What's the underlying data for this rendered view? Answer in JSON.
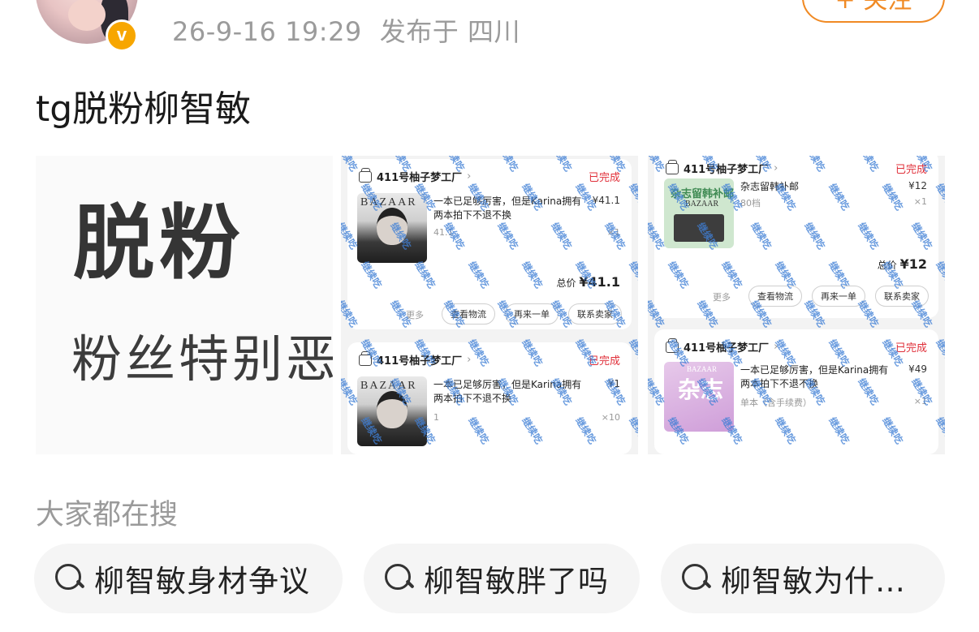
{
  "post": {
    "time": "26-9-16 19:29",
    "location": "发布于 四川",
    "follow_label": "+ 关注",
    "verified_badge": "v",
    "text": "tg脱粉柳智敏"
  },
  "image1": {
    "headline": "脱粉",
    "subline": "粉丝特别恶"
  },
  "order_shot_a": {
    "orders": [
      {
        "store": "411号柚子梦工厂",
        "status": "已完成",
        "item_name": "一本已足够厉害，但是Karina拥有两本拍下不退不换",
        "price": "¥41.1",
        "spec": "41.1",
        "qty": "×1",
        "total_label": "总价",
        "total_value": "¥41.1",
        "more": "更多",
        "actions": [
          "查看物流",
          "再来一单",
          "联系卖家"
        ],
        "thumb_mag": "BAZAAR"
      },
      {
        "store": "411号柚子梦工厂",
        "status": "已完成",
        "item_name": "一本已足够厉害，但是Karina拥有两本拍下不退不换",
        "price": "¥1",
        "spec": "1",
        "qty": "×10",
        "thumb_mag": "BAZAAR"
      }
    ]
  },
  "order_shot_b": {
    "orders": [
      {
        "store": "411号柚子梦工厂",
        "status": "已完成",
        "item_name": "杂志留韩补邮",
        "price": "¥12",
        "spec": "80档",
        "qty": "×1",
        "total_label": "总价",
        "total_value": "¥12",
        "more": "更多",
        "actions": [
          "查看物流",
          "再来一单",
          "联系卖家"
        ],
        "thumb_text": "杂志留韩补邮",
        "thumb_mag": "BAZAAR"
      },
      {
        "store": "411号柚子梦工厂",
        "status": "已完成",
        "item_name": "一本已足够厉害，但是Karina拥有两本拍下不退不换",
        "price": "¥49",
        "spec": "单本（含手续费）",
        "qty": "×1",
        "thumb_text": "杂志",
        "thumb_mag": "BAZAAR"
      }
    ]
  },
  "watermark": "继续吃",
  "search": {
    "title": "大家都在搜",
    "chips": [
      "柳智敏身材争议",
      "柳智敏胖了吗",
      "柳智敏为什…"
    ]
  },
  "colors": {
    "accent": "#f08a24",
    "status_red": "#e0303a",
    "watermark_blue": "#3f7fd6",
    "meta_gray": "#9b9b9b"
  }
}
